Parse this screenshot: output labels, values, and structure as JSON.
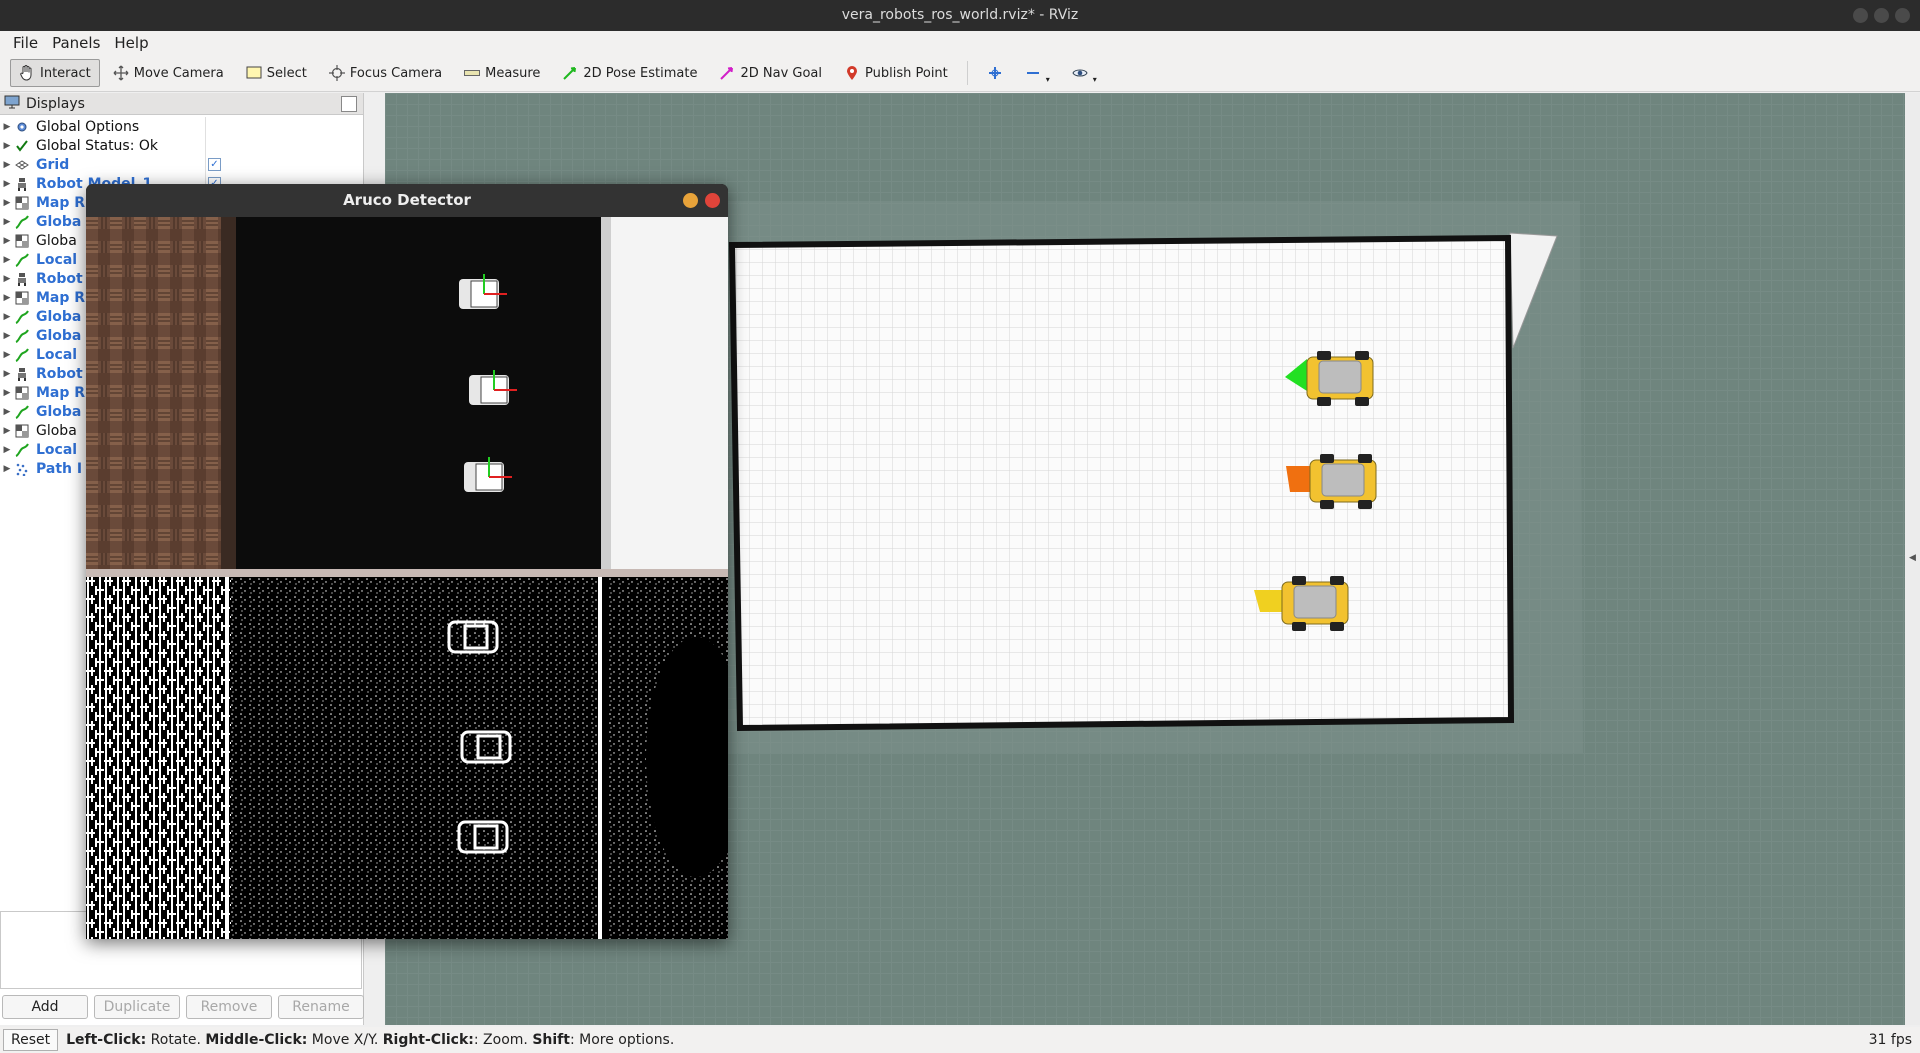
{
  "window": {
    "title": "vera_robots_ros_world.rviz* - RViz"
  },
  "menu": [
    "File",
    "Panels",
    "Help"
  ],
  "toolbar": {
    "tools": [
      {
        "label": "Interact",
        "icon": "cursor-hand-icon",
        "active": true
      },
      {
        "label": "Move Camera",
        "icon": "move-camera-icon",
        "active": false
      },
      {
        "label": "Select",
        "icon": "select-box-icon",
        "active": false
      },
      {
        "label": "Focus Camera",
        "icon": "focus-target-icon",
        "active": false
      },
      {
        "label": "Measure",
        "icon": "ruler-icon",
        "active": false
      },
      {
        "label": "2D Pose Estimate",
        "icon": "green-arrow-icon",
        "active": false
      },
      {
        "label": "2D Nav Goal",
        "icon": "magenta-arrow-icon",
        "active": false
      },
      {
        "label": "Publish Point",
        "icon": "map-pin-icon",
        "active": false
      }
    ]
  },
  "displays": {
    "title": "Displays",
    "items": [
      {
        "label": "Global Options",
        "style": "dark",
        "icon": "gear-icon",
        "checked": null
      },
      {
        "label": "Global Status: Ok",
        "style": "dark",
        "icon": "checkmark-icon",
        "checked": null
      },
      {
        "label": "Grid",
        "style": "blue",
        "icon": "grid-icon",
        "checked": true
      },
      {
        "label": "Robot Model_1",
        "style": "blue",
        "icon": "robot-model-icon",
        "checked": true
      },
      {
        "label": "Map R",
        "style": "blue",
        "icon": "map-icon",
        "checked": null
      },
      {
        "label": "Globa",
        "style": "blue",
        "icon": "path-icon",
        "checked": null
      },
      {
        "label": "Globa",
        "style": "dark",
        "icon": "map-icon",
        "checked": null
      },
      {
        "label": "Local",
        "style": "blue",
        "icon": "path-icon",
        "checked": null
      },
      {
        "label": "Robot",
        "style": "blue",
        "icon": "robot-model-icon",
        "checked": null
      },
      {
        "label": "Map R",
        "style": "blue",
        "icon": "map-icon",
        "checked": null
      },
      {
        "label": "Globa",
        "style": "blue",
        "icon": "path-icon",
        "checked": null
      },
      {
        "label": "Globa",
        "style": "blue",
        "icon": "path-icon",
        "checked": null
      },
      {
        "label": "Local",
        "style": "blue",
        "icon": "path-icon",
        "checked": null
      },
      {
        "label": "Robot",
        "style": "blue",
        "icon": "robot-model-icon",
        "checked": null
      },
      {
        "label": "Map R",
        "style": "blue",
        "icon": "map-icon",
        "checked": null
      },
      {
        "label": "Globa",
        "style": "blue",
        "icon": "path-icon",
        "checked": null
      },
      {
        "label": "Globa",
        "style": "dark",
        "icon": "map-icon",
        "checked": null
      },
      {
        "label": "Local",
        "style": "blue",
        "icon": "path-icon",
        "checked": null
      },
      {
        "label": "Path I",
        "style": "blue",
        "icon": "point-cloud-icon",
        "checked": null
      }
    ],
    "buttons": {
      "add": "Add",
      "duplicate": "Duplicate",
      "remove": "Remove",
      "rename": "Rename"
    }
  },
  "aruco": {
    "title": "Aruco Detector"
  },
  "statusbar": {
    "reset": "Reset",
    "hint_parts": [
      {
        "text": "Left-Click:",
        "bold": true
      },
      {
        "text": " Rotate. ",
        "bold": false
      },
      {
        "text": "Middle-Click:",
        "bold": true
      },
      {
        "text": " Move X/Y. ",
        "bold": false
      },
      {
        "text": "Right-Click:",
        "bold": true
      },
      {
        "text": ": Zoom. ",
        "bold": false
      },
      {
        "text": "Shift",
        "bold": true
      },
      {
        "text": ": More options.",
        "bold": false
      }
    ],
    "fps": "31 fps"
  },
  "colors": {
    "pose_marker_1": "#22e022",
    "pose_marker_2": "#f07010",
    "pose_marker_3": "#f0d020",
    "robot_body": "#f2c230",
    "background": "#6f857e"
  }
}
